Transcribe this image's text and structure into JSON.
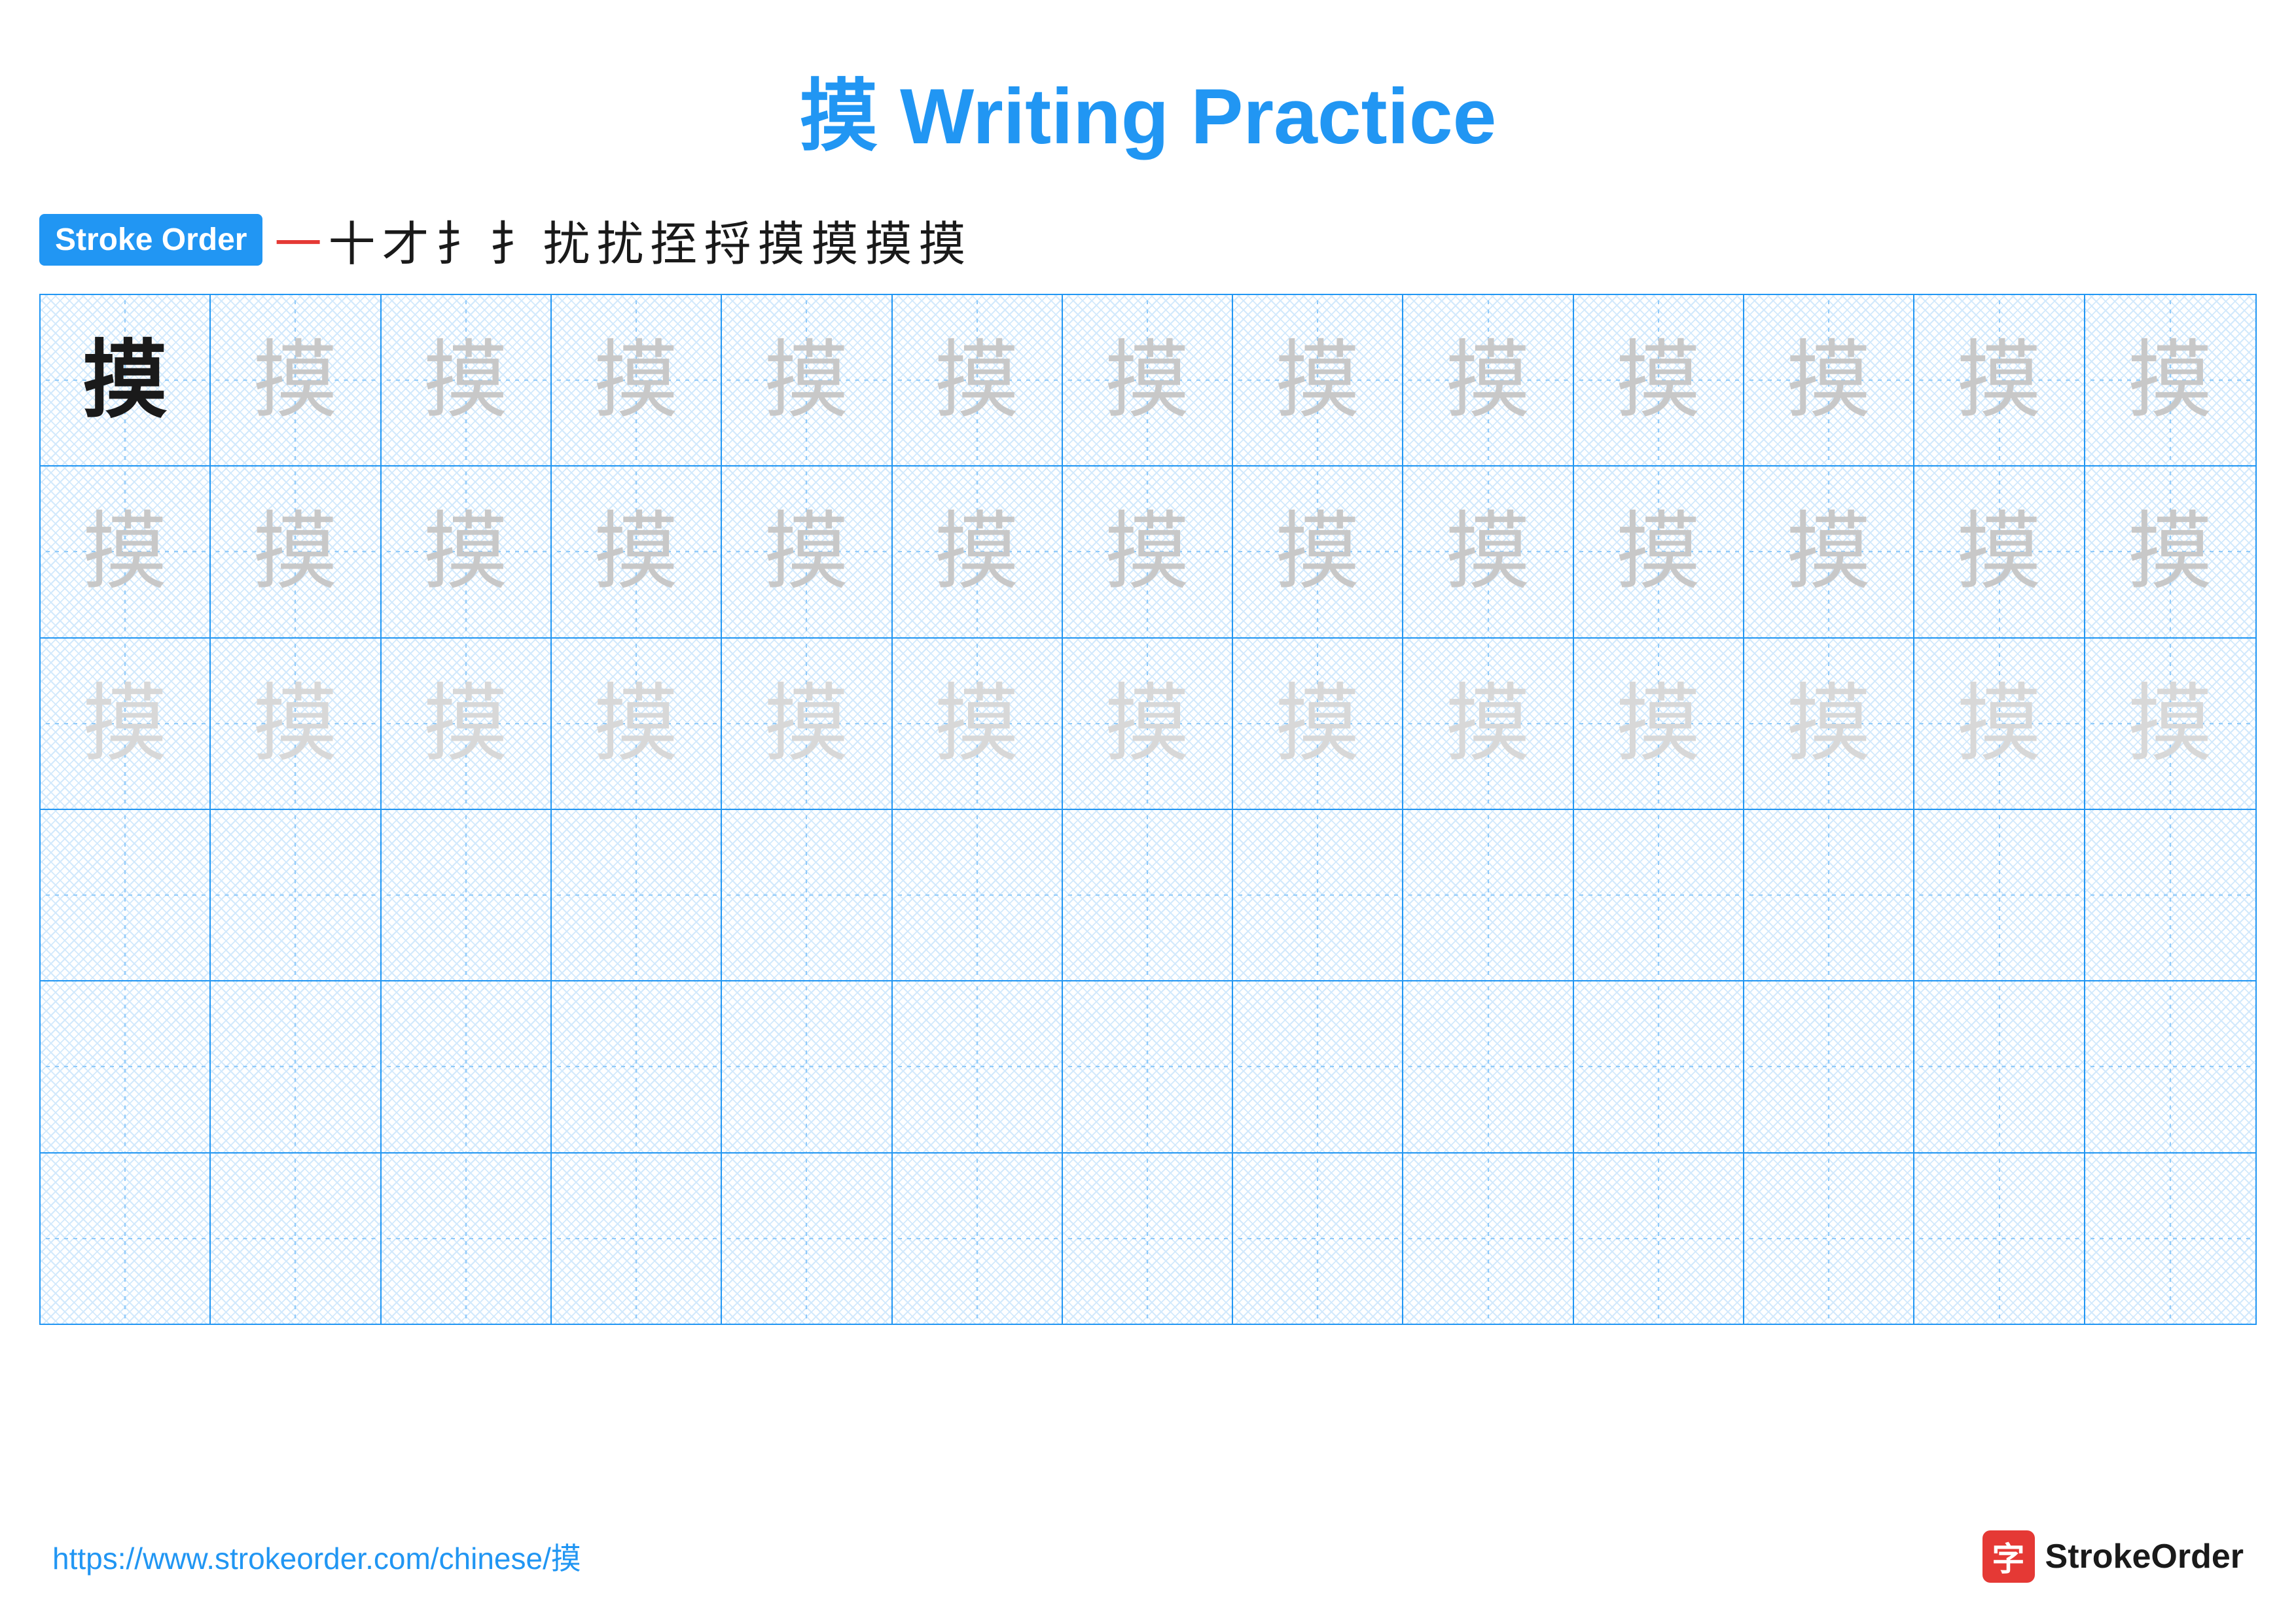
{
  "page": {
    "title": "摸 Writing Practice",
    "title_char": "摸",
    "title_suffix": " Writing Practice",
    "stroke_order_label": "Stroke Order",
    "stroke_chars": [
      "一",
      "十",
      "才",
      "扌",
      "扌",
      "扰",
      "扰",
      "挃",
      "捋",
      "摸",
      "摸",
      "摸",
      "摸"
    ],
    "stroke_chars_red_count": 1,
    "main_char": "摸",
    "grid_rows": 6,
    "grid_cols": 13,
    "row_configs": [
      {
        "type": "dark_then_light",
        "dark_count": 1,
        "light_count": 12
      },
      {
        "type": "all_light"
      },
      {
        "type": "all_lighter"
      },
      {
        "type": "empty"
      },
      {
        "type": "empty"
      },
      {
        "type": "empty"
      }
    ],
    "footer_url": "https://www.strokeorder.com/chinese/摸",
    "footer_logo_char": "字",
    "footer_logo_text": "StrokeOrder"
  }
}
